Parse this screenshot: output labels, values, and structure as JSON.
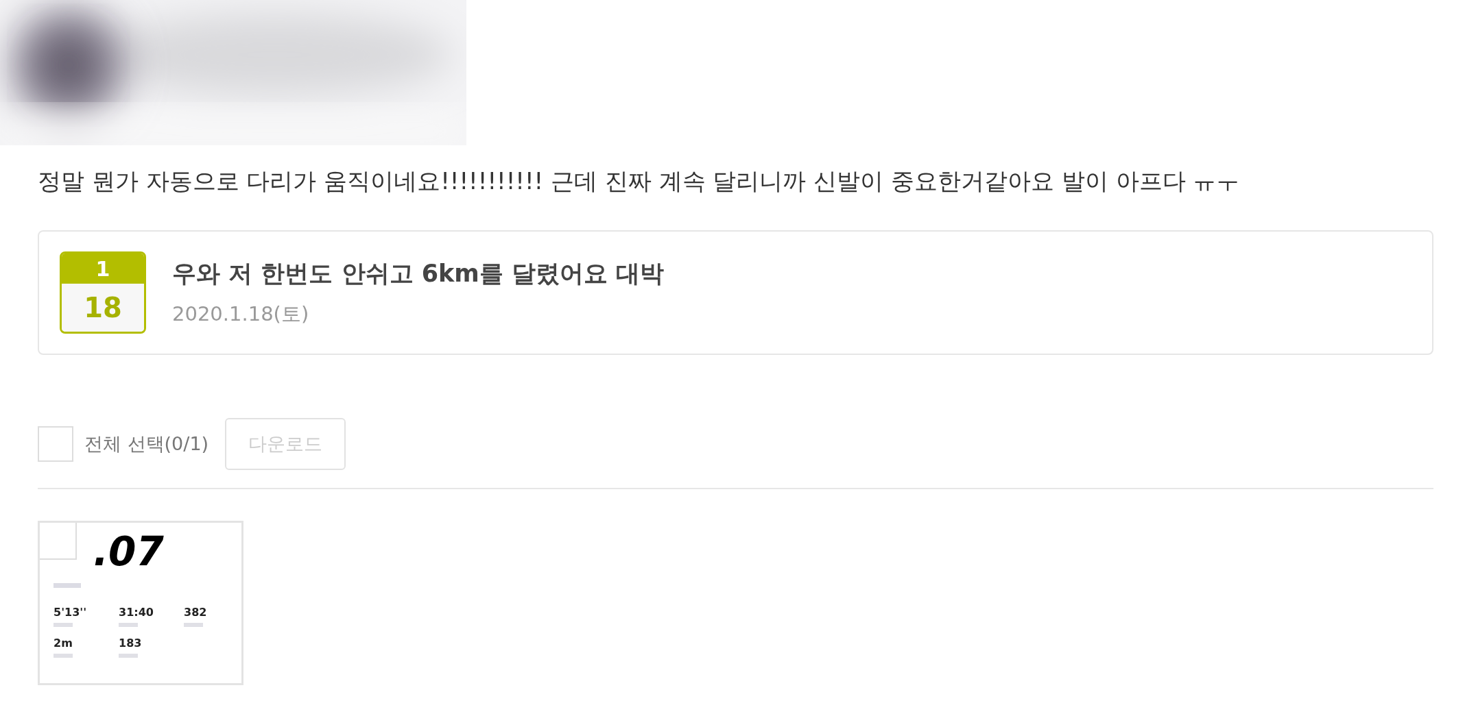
{
  "comment": "정말 뭔가 자동으로 다리가 움직이네요!!!!!!!!!!! 근데 진짜 계속 달리니까 신발이 중요한거같아요 발이 아프다 ㅠㅜ",
  "post_card": {
    "calendar": {
      "month": "1",
      "day": "18"
    },
    "title": "우와 저 한번도 안쉬고 6km를 달렸어요 대박",
    "date": "2020.1.18(토)"
  },
  "toolbar": {
    "select_all": {
      "checked": false,
      "label": "전체 선택(0/1)"
    },
    "download_button": {
      "label": "다운로드",
      "disabled": true
    }
  },
  "attachments": [
    {
      "selected": false,
      "distance": ".07",
      "stats": [
        "5'13''",
        "31:40",
        "382",
        "2m",
        "183"
      ]
    }
  ]
}
